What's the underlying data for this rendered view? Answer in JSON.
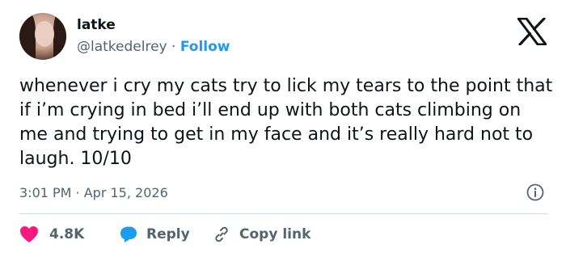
{
  "author": {
    "name": "latke",
    "handle": "@latkedelrey",
    "separator": "·",
    "follow_label": "Follow"
  },
  "tweet": {
    "text": "whenever i cry my cats try to lick my tears to the point that if i’m crying in bed i’ll end up with both cats climbing on me and trying to get in my face and it’s really hard not to laugh. 10/10",
    "timestamp": "3:01 PM · Apr 15, 2026"
  },
  "actions": {
    "like_count": "4.8K",
    "reply_label": "Reply",
    "copy_label": "Copy link"
  },
  "icons": {
    "brand": "x-logo-icon",
    "info": "info-icon",
    "like": "heart-icon",
    "reply": "speech-bubble-icon",
    "copy": "link-icon"
  },
  "colors": {
    "text": "#0f1419",
    "muted": "#536471",
    "accent": "#1d9bf0",
    "like": "#f91880",
    "divider": "#cfd9de"
  }
}
